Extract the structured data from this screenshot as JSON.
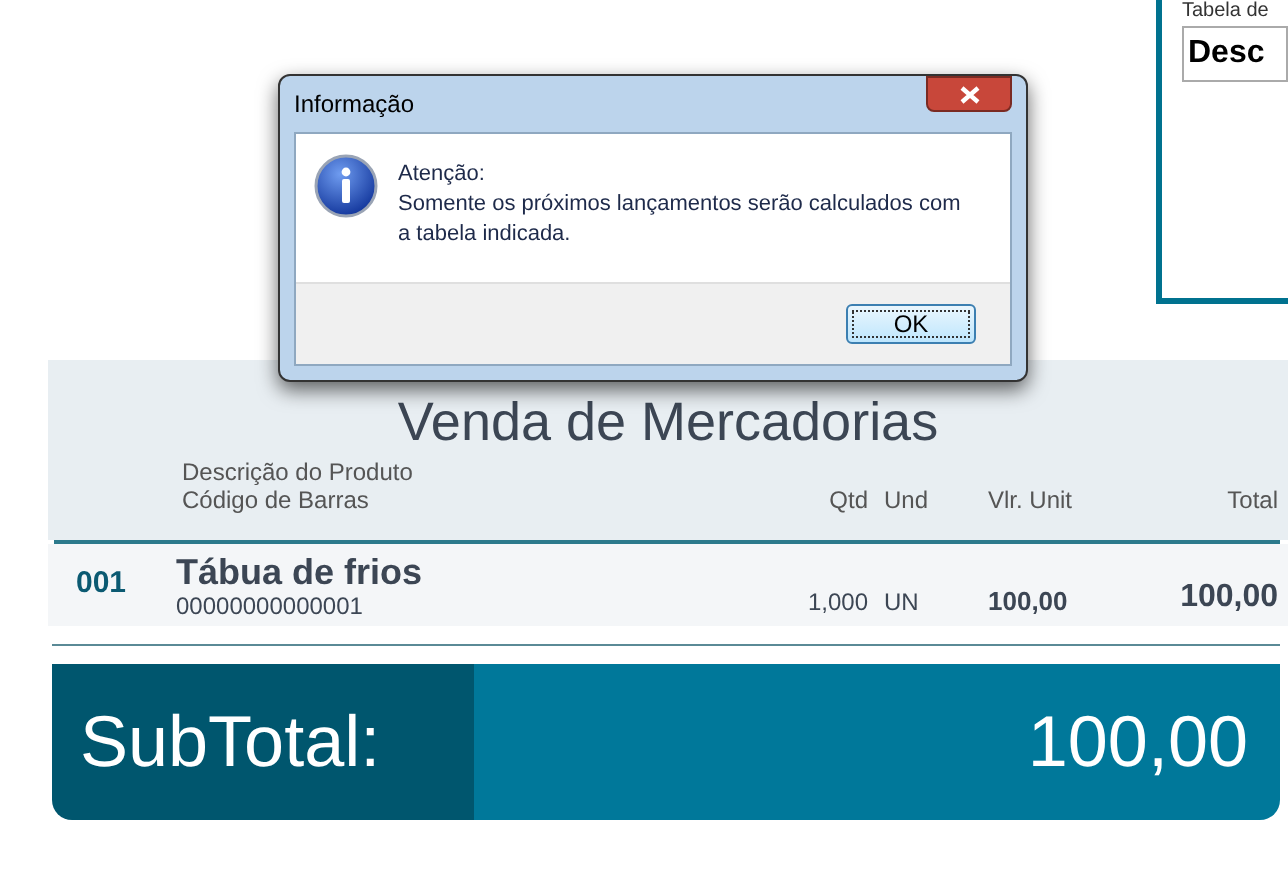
{
  "side_panel": {
    "label": "Tabela de",
    "field_value": "Desc"
  },
  "sale": {
    "title": "Venda de Mercadorias",
    "columns": {
      "description": "Descrição do Produto",
      "barcode": "Código de Barras",
      "qty": "Qtd",
      "unit": "Und",
      "unit_price": "Vlr. Unit",
      "total": "Total"
    },
    "rows": [
      {
        "number": "001",
        "name": "Tábua de frios",
        "barcode": "00000000000001",
        "qty": "1,000",
        "unit": "UN",
        "unit_price": "100,00",
        "total": "100,00"
      }
    ]
  },
  "subtotal": {
    "label": "SubTotal:",
    "value": "100,00"
  },
  "dialog": {
    "title": "Informação",
    "heading": "Atenção:",
    "message": "Somente os próximos lançamentos serão calculados com a tabela indicada.",
    "buttons": [
      "OK"
    ]
  }
}
